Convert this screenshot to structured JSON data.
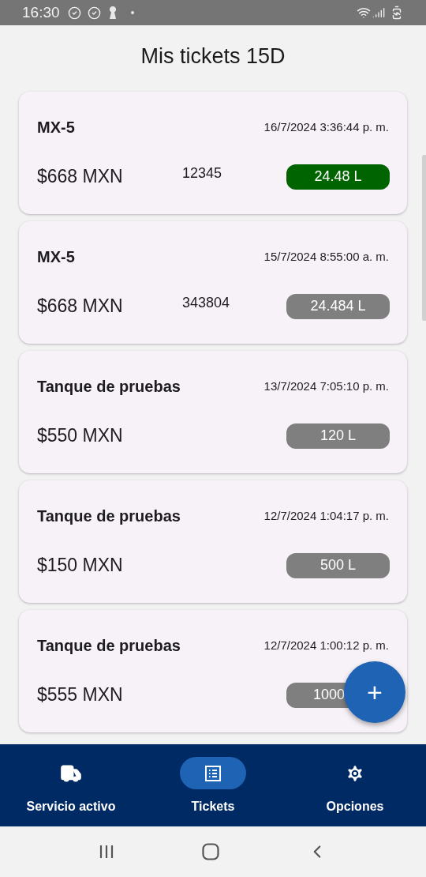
{
  "status_bar": {
    "time": "16:30"
  },
  "title": "Mis tickets 15D",
  "tickets": [
    {
      "name": "MX-5",
      "date": "16/7/2024 3:36:44 p. m.",
      "amount": "$668 MXN",
      "folio": "12345",
      "liters": "24.48 L",
      "color": "#006400"
    },
    {
      "name": "MX-5",
      "date": "15/7/2024 8:55:00 a. m.",
      "amount": "$668 MXN",
      "folio": "343804",
      "liters": "24.484 L",
      "color": "#7f7f7f"
    },
    {
      "name": "Tanque de pruebas",
      "date": "13/7/2024 7:05:10 p. m.",
      "amount": "$550 MXN",
      "liters": "120 L",
      "color": "#7f7f7f"
    },
    {
      "name": "Tanque de pruebas",
      "date": "12/7/2024 1:04:17 p. m.",
      "amount": "$150 MXN",
      "liters": "500 L",
      "color": "#7f7f7f"
    },
    {
      "name": "Tanque de pruebas",
      "date": "12/7/2024 1:00:12 p. m.",
      "amount": "$555 MXN",
      "liters": "1000",
      "color": "#7f7f7f"
    }
  ],
  "fab": {
    "label": "+"
  },
  "bottom_nav": [
    {
      "label": "Servicio activo",
      "kind": "truck",
      "selected": false
    },
    {
      "label": "Tickets",
      "kind": "list",
      "selected": true
    },
    {
      "label": "Opciones",
      "kind": "settings",
      "selected": false
    }
  ]
}
